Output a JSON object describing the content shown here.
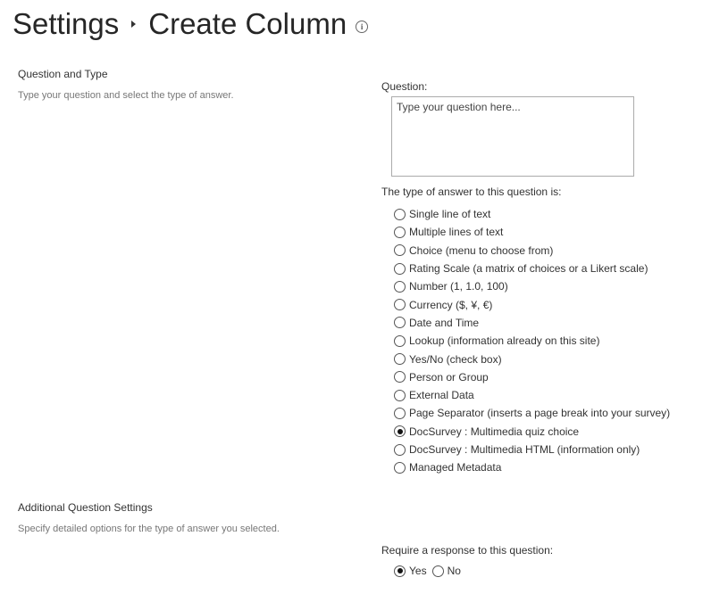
{
  "header": {
    "breadcrumb_parent": "Settings",
    "page_title": "Create Column",
    "info_icon": "info-circle-icon",
    "info_glyph": "i"
  },
  "question_section": {
    "title": "Question and Type",
    "description": "Type your question and select the type of answer.",
    "question_label": "Question:",
    "question_value": "",
    "question_placeholder": "Type your question here...",
    "answer_type_label": "The type of answer to this question is:",
    "answer_types": [
      {
        "label": "Single line of text",
        "checked": false
      },
      {
        "label": "Multiple lines of text",
        "checked": false
      },
      {
        "label": "Choice (menu to choose from)",
        "checked": false
      },
      {
        "label": "Rating Scale (a matrix of choices or a Likert scale)",
        "checked": false
      },
      {
        "label": "Number (1, 1.0, 100)",
        "checked": false
      },
      {
        "label": "Currency ($, ¥, €)",
        "checked": false
      },
      {
        "label": "Date and Time",
        "checked": false
      },
      {
        "label": "Lookup (information already on this site)",
        "checked": false
      },
      {
        "label": "Yes/No (check box)",
        "checked": false
      },
      {
        "label": "Person or Group",
        "checked": false
      },
      {
        "label": "External Data",
        "checked": false
      },
      {
        "label": "Page Separator (inserts a page break into your survey)",
        "checked": false
      },
      {
        "label": "DocSurvey : Multimedia quiz choice",
        "checked": true
      },
      {
        "label": "DocSurvey : Multimedia HTML (information only)",
        "checked": false
      },
      {
        "label": "Managed Metadata",
        "checked": false
      }
    ]
  },
  "additional_section": {
    "title": "Additional Question Settings",
    "description": "Specify detailed options for the type of answer you selected.",
    "require_label": "Require a response to this question:",
    "require_options": [
      {
        "label": "Yes",
        "checked": true
      },
      {
        "label": "No",
        "checked": false
      }
    ]
  }
}
